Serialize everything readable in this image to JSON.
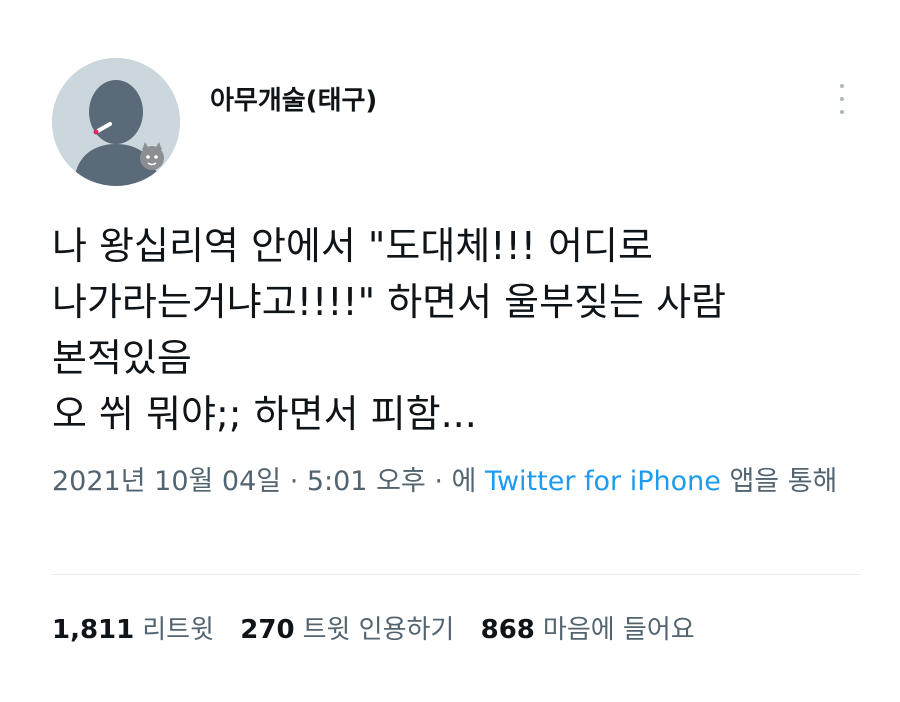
{
  "user": {
    "display_name": "아무개술(태구)",
    "avatar_icon": "default-profile-avatar-icon"
  },
  "tweet": {
    "lines": [
      "나 왕십리역 안에서 \"도대체!!! 어디로",
      "나가라는거냐고!!!!\" 하면서 울부짖는 사람",
      "본적있음",
      "오 쒸 뭐야;; 하면서 피함..."
    ]
  },
  "meta": {
    "timestamp": "2021년 10월 04일 · 5:01 오후 · 에 ",
    "source": "Twitter for iPhone",
    "suffix": " 앱을 통해"
  },
  "stats": {
    "retweets": {
      "count": "1,811",
      "label": "리트윗"
    },
    "quotes": {
      "count": "270",
      "label": "트윗 인용하기"
    },
    "likes": {
      "count": "868",
      "label": "마음에 들어요"
    }
  },
  "colors": {
    "accent": "#1d9bf0",
    "text": "#0f1419",
    "secondary": "#536471",
    "avatar_bg": "#ccd6dd",
    "avatar_silhouette": "#5b6a78"
  }
}
